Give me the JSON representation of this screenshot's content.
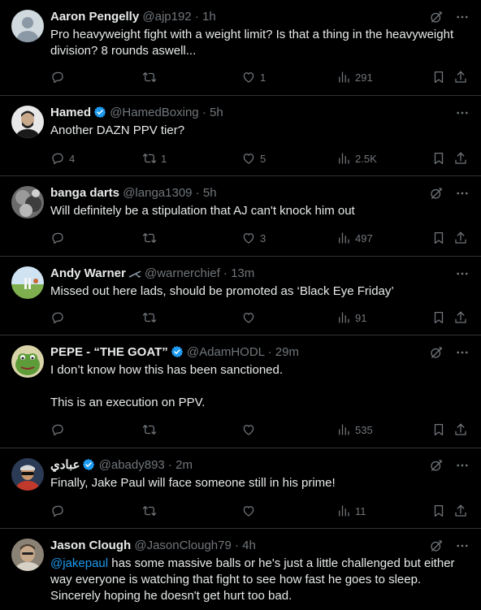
{
  "tweets": [
    {
      "name": "Aaron Pengelly",
      "handle": "@ajp192",
      "sep": " · ",
      "time": "1h",
      "text": "Pro heavyweight fight with a weight limit? Is that a thing in the heavyweight division? 8 rounds aswell...",
      "replies": "",
      "retweets": "",
      "likes": "1",
      "views": "291",
      "verified": false
    },
    {
      "name": "Hamed",
      "handle": "@HamedBoxing",
      "sep": " · ",
      "time": "5h",
      "text": "Another DAZN PPV tier?",
      "replies": "4",
      "retweets": "1",
      "likes": "5",
      "views": "2.5K",
      "verified": true
    },
    {
      "name": "banga darts",
      "handle": "@langa1309",
      "sep": " · ",
      "time": "5h",
      "text": "Will definitely be a stipulation that AJ can't knock him out",
      "replies": "",
      "retweets": "",
      "likes": "3",
      "views": "497",
      "verified": false
    },
    {
      "name": "Andy Warner",
      "handle": "@warnerchief",
      "sep": " · ",
      "time": "13m",
      "text": "Missed out here lads, should be promoted as ‘Black Eye Friday’",
      "replies": "",
      "retweets": "",
      "likes": "",
      "views": "91",
      "verified": false
    },
    {
      "name": "PEPE - “THE GOAT”",
      "handle": "@AdamHODL",
      "sep": " · ",
      "time": "29m",
      "text": "I don’t know how this has been sanctioned.\n\nThis is an execution on PPV.",
      "replies": "",
      "retweets": "",
      "likes": "",
      "views": "535",
      "verified": true
    },
    {
      "name": "عبادي",
      "handle": "@abady893",
      "sep": " · ",
      "time": "2m",
      "text": "Finally, Jake Paul will face someone still in his prime!",
      "replies": "",
      "retweets": "",
      "likes": "",
      "views": "11",
      "verified": true
    },
    {
      "name": "Jason Clough",
      "handle": "@JasonClough79",
      "sep": " · ",
      "time": "4h",
      "mention": "@jakepaul",
      "text": " has some massive balls or he's just a little challenged but either way everyone is watching that fight to see how fast he goes to sleep. Sincerely hoping he doesn't get hurt too bad.",
      "replies": "",
      "retweets": "",
      "likes": "",
      "views": "",
      "verified": false
    }
  ],
  "colors": {
    "accent": "#1d9bf0",
    "muted": "#71767b",
    "text": "#e7e9ea",
    "background": "#000000"
  },
  "icons": [
    "reply-icon",
    "retweet-icon",
    "like-icon",
    "views-icon",
    "bookmark-icon",
    "share-icon",
    "grok-icon",
    "more-icon",
    "verified-badge-icon"
  ]
}
